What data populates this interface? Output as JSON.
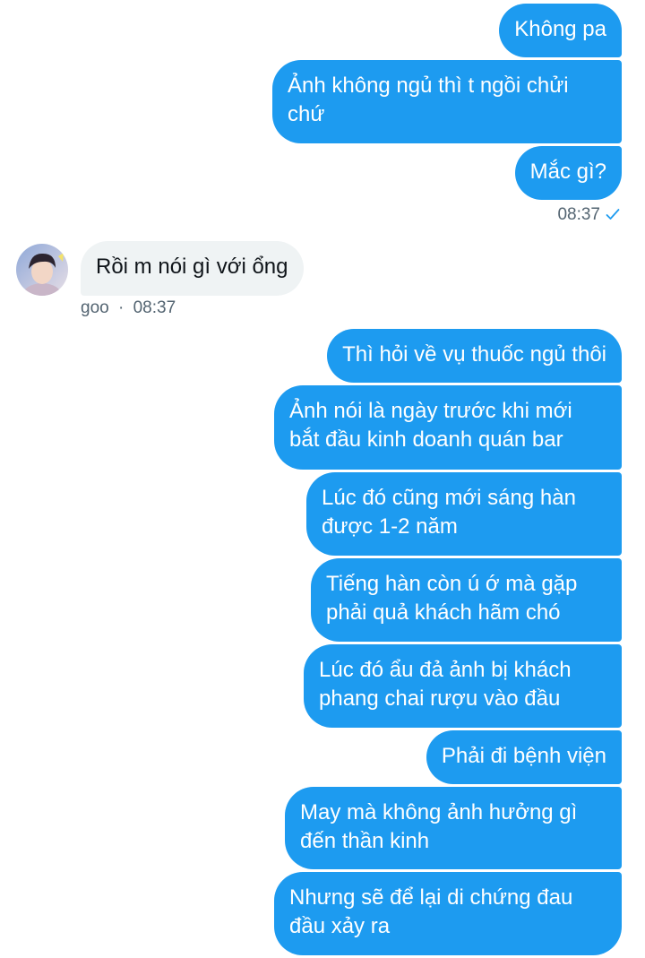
{
  "conversation": {
    "outgoing_group_1": [
      "Không pa",
      "Ảnh không ngủ thì t ngồi chửi chứ",
      "Mắc gì?"
    ],
    "outgoing_group_1_time": "08:37",
    "incoming": {
      "text": "Rồi m nói gì với ổng",
      "sender": "goo",
      "separator": "·",
      "time": "08:37"
    },
    "outgoing_group_2": [
      "Thì hỏi về vụ thuốc ngủ thôi",
      "Ảnh nói là ngày trước khi mới bắt đầu kinh doanh quán bar",
      "Lúc đó cũng mới sáng hàn được 1-2 năm",
      "Tiếng hàn còn ú ớ mà gặp phải quả khách hãm chó",
      "Lúc đó ẩu đả ảnh bị khách phang chai rượu vào đầu",
      "Phải đi bệnh viện",
      "May mà không ảnh hưởng gì đến thần kinh",
      "Nhưng sẽ để lại di chứng đau đầu xảy ra"
    ]
  },
  "icons": {
    "sent_status": "checkmark-icon",
    "avatar": "user-avatar"
  },
  "colors": {
    "outgoing_bubble": "#1d9bf0",
    "incoming_bubble": "#eff3f4",
    "meta_text": "#536471",
    "check": "#1d9bf0"
  }
}
